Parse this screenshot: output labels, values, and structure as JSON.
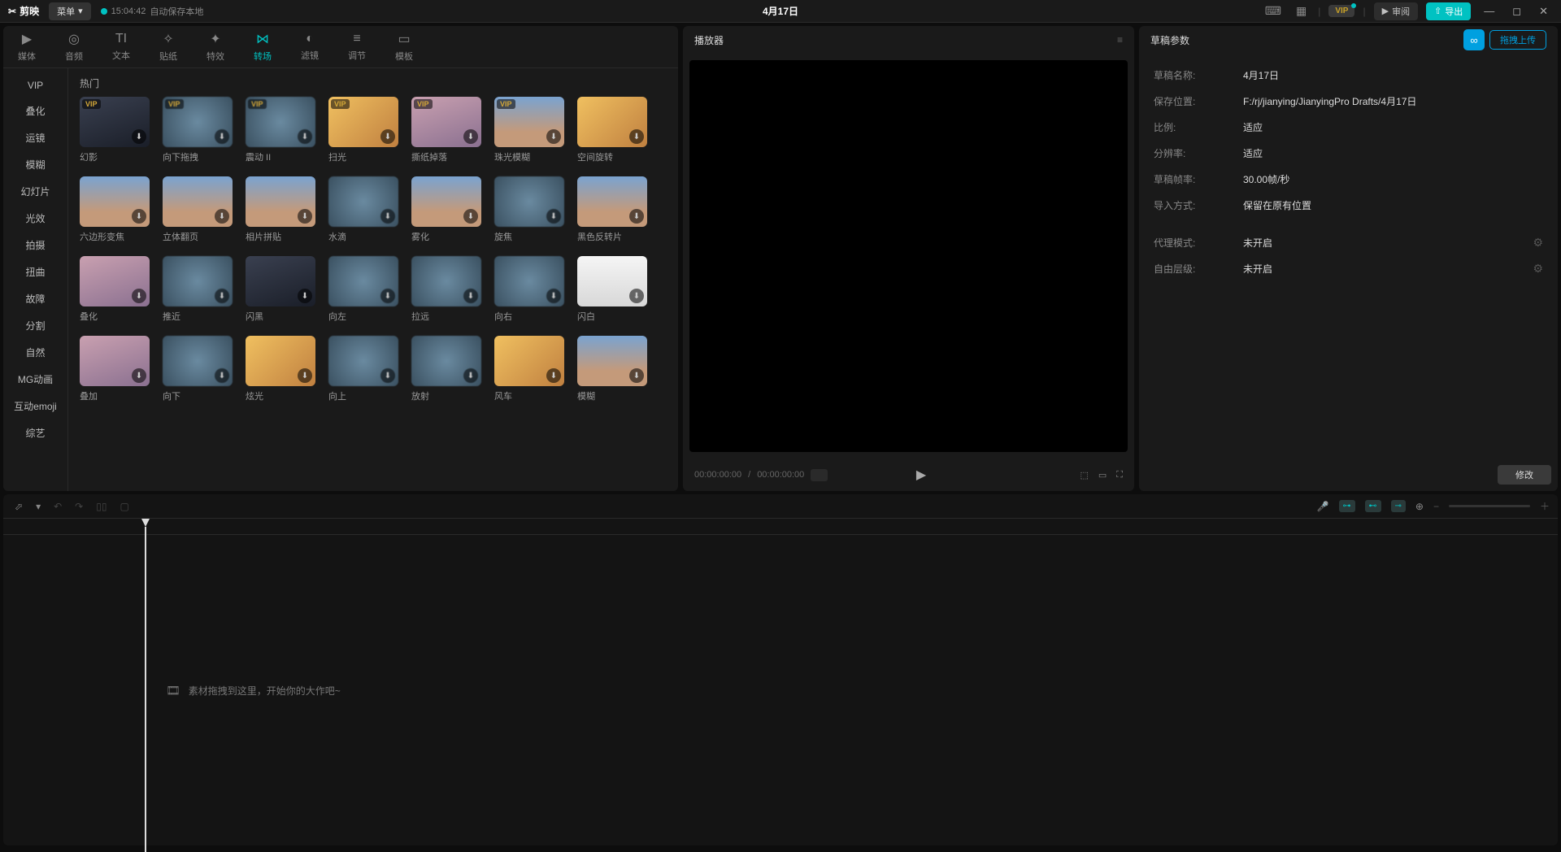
{
  "titlebar": {
    "app_name": "剪映",
    "menu_label": "菜单",
    "autosave_time": "15:04:42",
    "autosave_text": "自动保存本地",
    "project_title": "4月17日",
    "vip_label": "VIP",
    "review_label": "审阅",
    "export_label": "导出"
  },
  "tabs": [
    {
      "id": "media",
      "label": "媒体",
      "icon": "▶"
    },
    {
      "id": "audio",
      "label": "音频",
      "icon": "◎"
    },
    {
      "id": "text",
      "label": "文本",
      "icon": "TI"
    },
    {
      "id": "sticker",
      "label": "贴纸",
      "icon": "✧"
    },
    {
      "id": "effect",
      "label": "特效",
      "icon": "✦"
    },
    {
      "id": "transition",
      "label": "转场",
      "icon": "⋈",
      "active": true
    },
    {
      "id": "filter",
      "label": "滤镜",
      "icon": "◐"
    },
    {
      "id": "adjust",
      "label": "调节",
      "icon": "≡"
    },
    {
      "id": "template",
      "label": "模板",
      "icon": "▭"
    }
  ],
  "sidebar": [
    "VIP",
    "叠化",
    "运镜",
    "模糊",
    "幻灯片",
    "光效",
    "拍摄",
    "扭曲",
    "故障",
    "分割",
    "自然",
    "MG动画",
    "互动emoji",
    "综艺"
  ],
  "section_label": "热门",
  "grid_items": [
    {
      "label": "幻影",
      "vip": true,
      "cls": "dark"
    },
    {
      "label": "向下拖拽",
      "vip": true,
      "cls": "blur"
    },
    {
      "label": "震动 II",
      "vip": true,
      "cls": "blur"
    },
    {
      "label": "扫光",
      "vip": true,
      "cls": "warm"
    },
    {
      "label": "撕纸掉落",
      "vip": true,
      "cls": "pink"
    },
    {
      "label": "珠光模糊",
      "vip": true,
      "cls": "sky"
    },
    {
      "label": "空间旋转",
      "vip": false,
      "cls": "warm"
    },
    {
      "label": "六边形变焦",
      "vip": false,
      "cls": "sky"
    },
    {
      "label": "立体翻页",
      "vip": false,
      "cls": "sky"
    },
    {
      "label": "相片拼贴",
      "vip": false,
      "cls": "sky"
    },
    {
      "label": "水滴",
      "vip": false,
      "cls": "blur"
    },
    {
      "label": "雾化",
      "vip": false,
      "cls": "sky"
    },
    {
      "label": "旋焦",
      "vip": false,
      "cls": "blur"
    },
    {
      "label": "黑色反转片",
      "vip": false,
      "cls": "sky"
    },
    {
      "label": "叠化",
      "vip": false,
      "cls": "pink"
    },
    {
      "label": "推近",
      "vip": false,
      "cls": "blur"
    },
    {
      "label": "闪黑",
      "vip": false,
      "cls": "dark"
    },
    {
      "label": "向左",
      "vip": false,
      "cls": "blur"
    },
    {
      "label": "拉远",
      "vip": false,
      "cls": "blur"
    },
    {
      "label": "向右",
      "vip": false,
      "cls": "blur"
    },
    {
      "label": "闪白",
      "vip": false,
      "cls": "white"
    },
    {
      "label": "叠加",
      "vip": false,
      "cls": "pink"
    },
    {
      "label": "向下",
      "vip": false,
      "cls": "blur"
    },
    {
      "label": "炫光",
      "vip": false,
      "cls": "warm"
    },
    {
      "label": "向上",
      "vip": false,
      "cls": "blur"
    },
    {
      "label": "放射",
      "vip": false,
      "cls": "blur"
    },
    {
      "label": "风车",
      "vip": false,
      "cls": "warm"
    },
    {
      "label": "模糊",
      "vip": false,
      "cls": "sky"
    }
  ],
  "preview": {
    "title": "播放器",
    "time_current": "00:00:00:00",
    "time_total": "00:00:00:00"
  },
  "props": {
    "title": "草稿参数",
    "upload_label": "拖拽上传",
    "rows": [
      {
        "label": "草稿名称:",
        "value": "4月17日"
      },
      {
        "label": "保存位置:",
        "value": "F:/rj/jianying/JianyingPro Drafts/4月17日"
      },
      {
        "label": "比例:",
        "value": "适应"
      },
      {
        "label": "分辨率:",
        "value": "适应"
      },
      {
        "label": "草稿帧率:",
        "value": "30.00帧/秒"
      },
      {
        "label": "导入方式:",
        "value": "保留在原有位置"
      }
    ],
    "rows2": [
      {
        "label": "代理模式:",
        "value": "未开启"
      },
      {
        "label": "自由层级:",
        "value": "未开启"
      }
    ],
    "modify_label": "修改"
  },
  "timeline": {
    "hint": "素材拖拽到这里，开始你的大作吧~"
  }
}
